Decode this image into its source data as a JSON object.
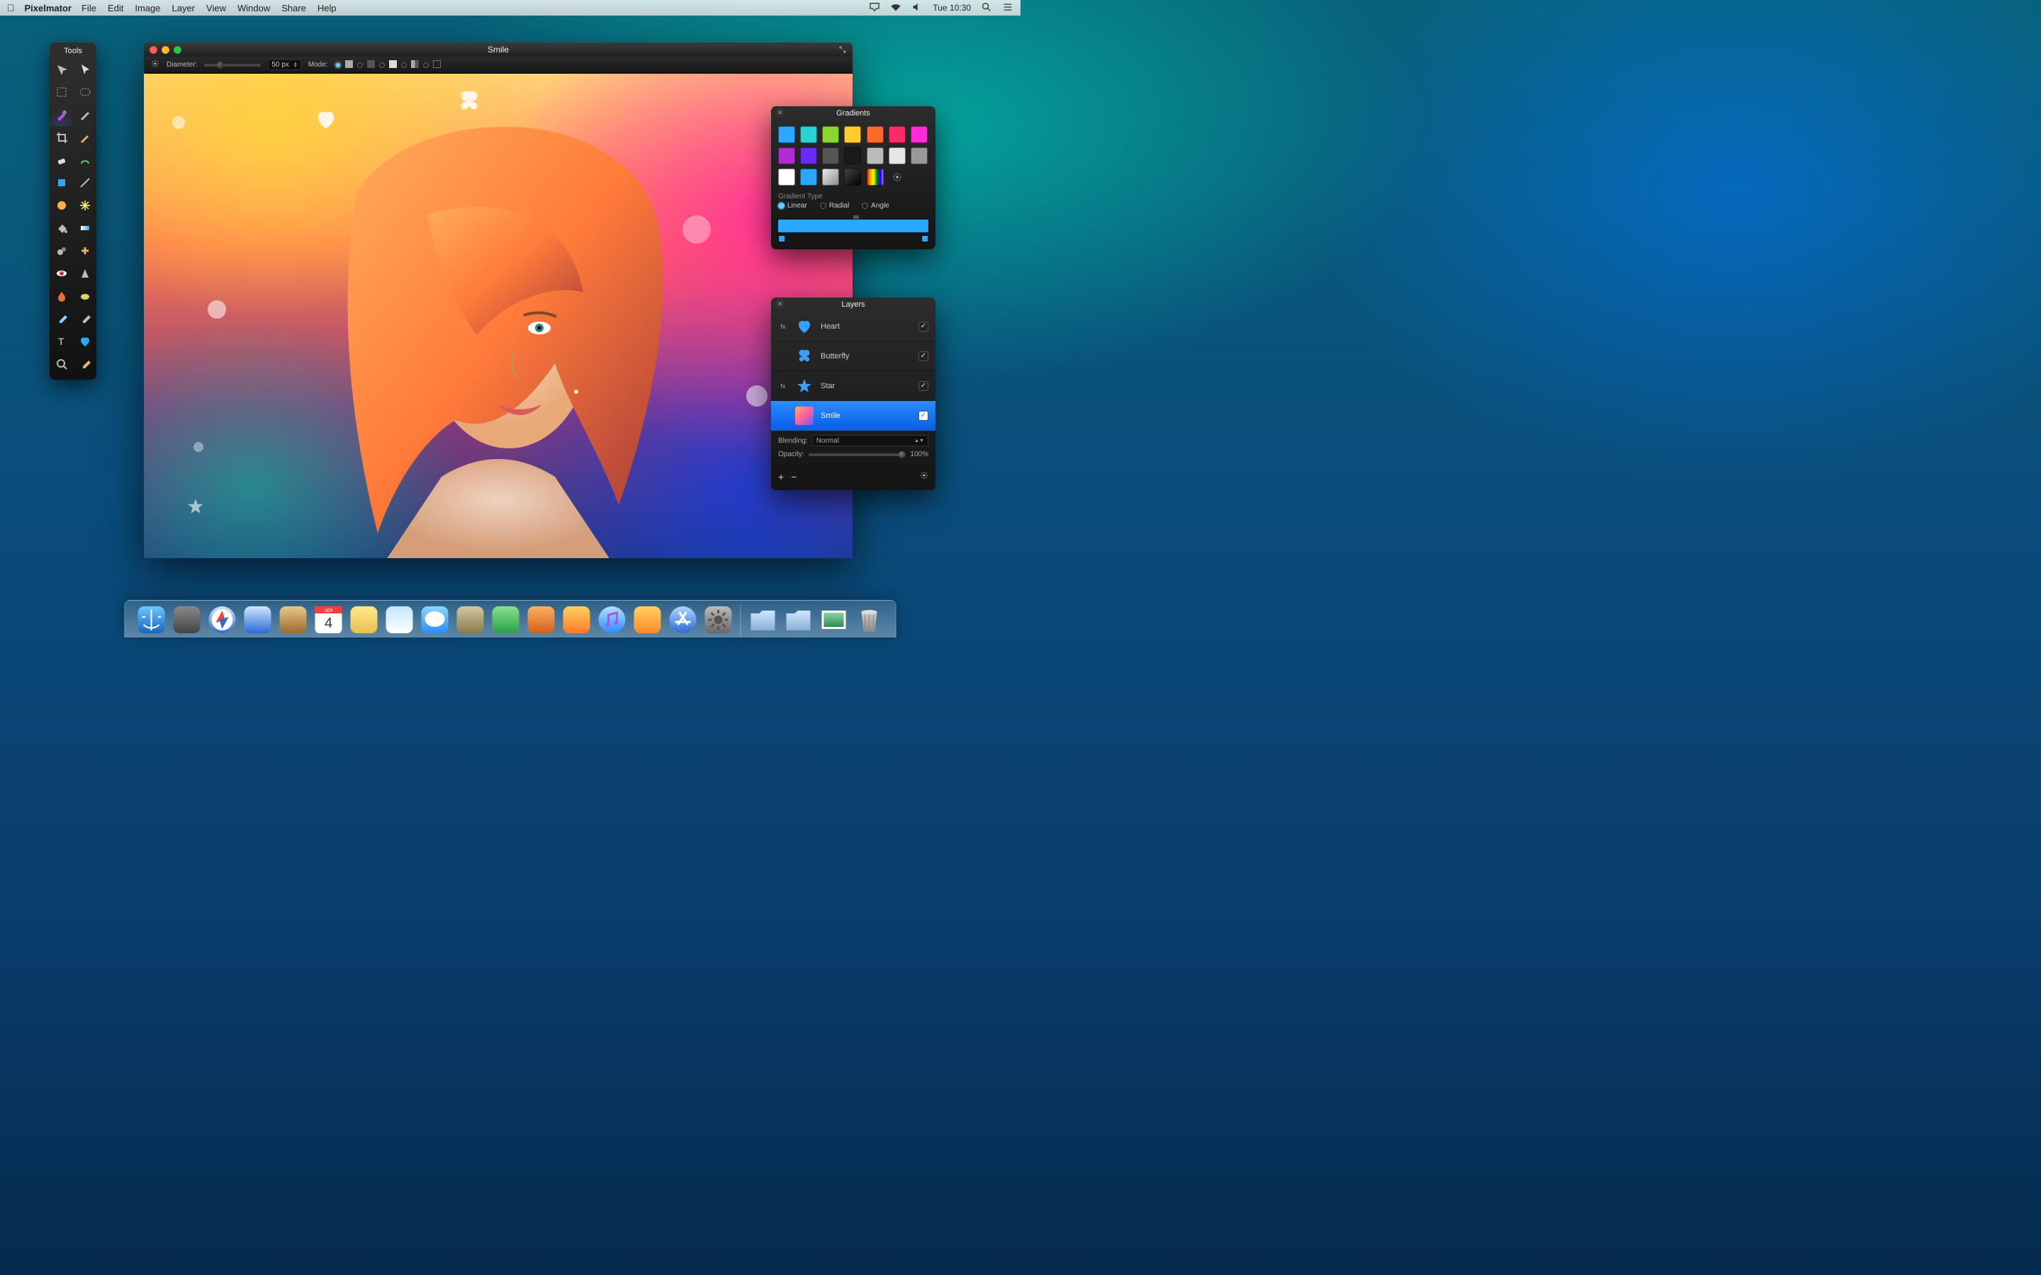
{
  "menubar": {
    "app_name": "Pixelmator",
    "items": [
      "File",
      "Edit",
      "Image",
      "Layer",
      "View",
      "Window",
      "Share",
      "Help"
    ],
    "clock": "Tue 10:30"
  },
  "tools_panel": {
    "title": "Tools",
    "tools": [
      "move-tool",
      "pointer-tool",
      "marquee-tool",
      "lasso-tool",
      "brush-tool",
      "pen-tool",
      "crop-tool",
      "pencil-tool",
      "eraser-tool",
      "smudge-tool",
      "shape-tool",
      "line-tool",
      "blur-tool",
      "sparkle-tool",
      "paint-bucket-tool",
      "gradient-tool",
      "clone-tool",
      "heal-tool",
      "redeye-tool",
      "sharpen-tool",
      "burn-tool",
      "sponge-tool",
      "eyedropper-tool",
      "color-picker-tool",
      "type-tool",
      "heart-shape-tool",
      "zoom-tool",
      "hand-tool"
    ]
  },
  "document": {
    "title": "Smile",
    "toolbar": {
      "diameter_label": "Diameter:",
      "diameter_value": "50 px",
      "mode_label": "Mode:"
    }
  },
  "gradients_panel": {
    "title": "Gradients",
    "section_label": "Gradient Type",
    "types": {
      "linear": "Linear",
      "radial": "Radial",
      "angle": "Angle"
    },
    "selected_type": "Linear",
    "swatches": [
      "#2aa8ff",
      "#29d3d3",
      "#8bd62a",
      "#ffcc29",
      "#ff6a29",
      "#ff2a6a",
      "#ff2ad6",
      "#b02ad6",
      "#6a2aff",
      "#555555",
      "#1a1a1a",
      "#bbbbbb",
      "#e6e6e6",
      "#999999",
      "#ffffff",
      "#2aa8ff",
      "silver-grad",
      "black-grad",
      "rainbow",
      "gear"
    ]
  },
  "layers_panel": {
    "title": "Layers",
    "layers": [
      {
        "name": "Heart",
        "fx": true,
        "icon": "heart",
        "visible": true
      },
      {
        "name": "Butterfly",
        "fx": false,
        "icon": "butterfly",
        "visible": true
      },
      {
        "name": "Star",
        "fx": true,
        "icon": "star",
        "visible": true
      },
      {
        "name": "Smile",
        "fx": false,
        "icon": "image",
        "visible": true,
        "selected": true
      }
    ],
    "blending_label": "Blending:",
    "blending_value": "Normal",
    "opacity_label": "Opacity:",
    "opacity_value": "100%"
  },
  "dock": {
    "items": [
      "finder",
      "launchpad",
      "safari",
      "mail",
      "contacts",
      "calendar",
      "notes",
      "reminders",
      "messages",
      "maps",
      "facetime",
      "photobooth",
      "photos",
      "itunes",
      "ibooks",
      "appstore",
      "preferences"
    ],
    "right_items": [
      "documents",
      "downloads",
      "pictures",
      "trash"
    ],
    "calendar_day": "4",
    "calendar_month": "SEP"
  }
}
